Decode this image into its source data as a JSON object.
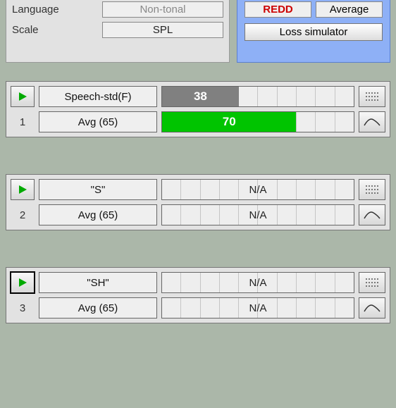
{
  "left_panel": {
    "row1": {
      "label": "Language",
      "value": "Non-tonal"
    },
    "row2": {
      "label": "Scale",
      "value": "SPL"
    }
  },
  "right_panel": {
    "mode1": "REDD",
    "mode2": "Average",
    "button": "Loss simulator"
  },
  "tests": [
    {
      "num": "1",
      "top_name": "Speech-std(F)",
      "bottom_name": "Avg (65)",
      "top_val": "38",
      "top_pct": 40,
      "top_color": "_gray",
      "bottom_val": "70",
      "bottom_pct": 70,
      "bottom_color": "_green",
      "na": false,
      "selected": false
    },
    {
      "num": "2",
      "top_name": "\"S\"",
      "bottom_name": "Avg (65)",
      "top_val": "N/A",
      "bottom_val": "N/A",
      "na": true,
      "selected": false
    },
    {
      "num": "3",
      "top_name": "\"SH\"",
      "bottom_name": "Avg (65)",
      "top_val": "N/A",
      "bottom_val": "N/A",
      "na": true,
      "selected": true
    }
  ]
}
